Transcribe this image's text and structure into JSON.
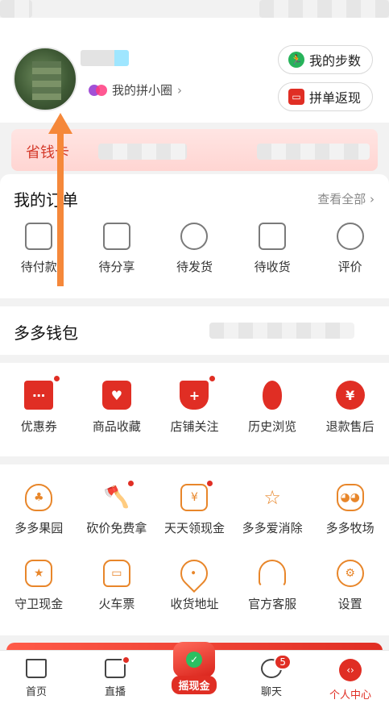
{
  "header": {
    "circle_label": "我的拼小圈",
    "steps_label": "我的步数",
    "refund_label": "拼单返现"
  },
  "save_card": {
    "label": "省钱卡"
  },
  "orders": {
    "title": "我的订单",
    "view_all": "查看全部",
    "items": [
      "待付款",
      "待分享",
      "待发货",
      "待收货",
      "评价"
    ]
  },
  "wallet": {
    "title": "多多钱包"
  },
  "tools1": [
    "优惠券",
    "商品收藏",
    "店铺关注",
    "历史浏览",
    "退款售后"
  ],
  "tools2_row1": [
    "多多果园",
    "砍价免费拿",
    "天天领现金",
    "多多爱消除",
    "多多牧场"
  ],
  "tools2_row2": [
    "守卫现金",
    "火车票",
    "收货地址",
    "官方客服",
    "设置"
  ],
  "tabbar": {
    "home": "首页",
    "live": "直播",
    "shake": "摇现金",
    "chat": "聊天",
    "chat_badge": "5",
    "me": "个人中心"
  },
  "colors": {
    "accent": "#e02e24",
    "orange": "#e8862a",
    "annotation": "#f5883a"
  }
}
